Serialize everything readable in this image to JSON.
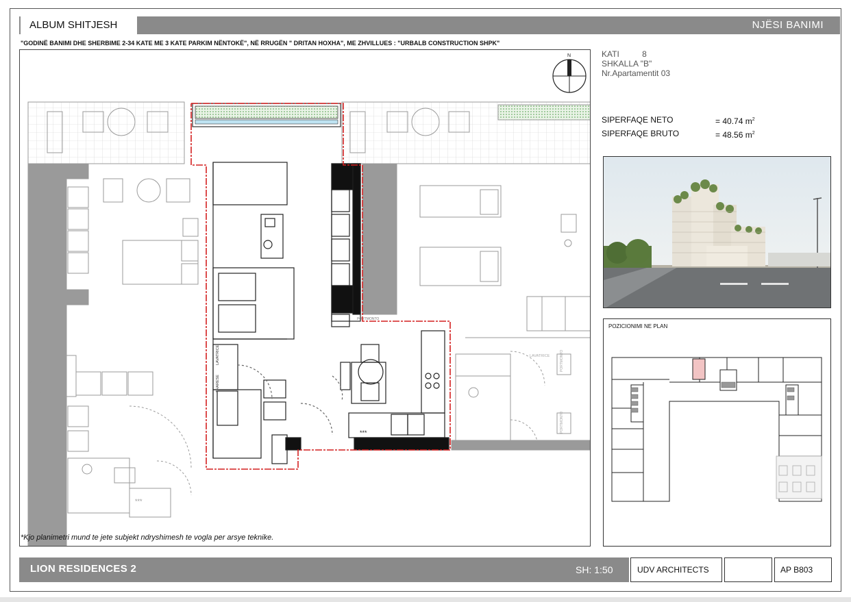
{
  "header": {
    "album_title": "ALBUM SHITJESH",
    "unit_title": "NJËSI BANIMI",
    "subtitle": "\"GODINË BANIMI DHE SHERBIME 2-34 KATE  ME 3 KATE PARKIM NËNTOKË\", NË RRUGËN \" DRITAN HOXHA\", ME  ZHVILLUES : \"URBALB CONSTRUCTION SHPK\""
  },
  "unit_info": {
    "floor_label": "KATI",
    "floor_value": "8",
    "stair": "SHKALLA \"B\"",
    "apartment": "Nr.Apartamentit  03"
  },
  "areas": {
    "net_label": "SIPERFAQE NETO",
    "net_value": "= 40.74 m",
    "gross_label": "SIPERFAQE BRUTO",
    "gross_value": "= 48.56 m",
    "unit_sup": "2"
  },
  "plan": {
    "compass_label": "N",
    "lavatrice_left": "LAVATRICE",
    "tharese": "THARESE",
    "lavatrice_right": "LAVATRICE",
    "portmonto_1": "PORTMONTO",
    "portmonto_2": "PORTMONTO",
    "portmonto_3": "PORTMONTO",
    "stars_1": "***",
    "stars_2": "***"
  },
  "location": {
    "title": "POZICIONIMI NE PLAN"
  },
  "note": "*Kjo planimetri mund te jete subjekt ndryshimesh te vogla per arsye teknike.",
  "footer": {
    "project": "LION  RESIDENCES 2",
    "scale": "SH: 1:50",
    "architect": "UDV ARCHITECTS",
    "code": "AP  B803"
  },
  "colors": {
    "bar_gray": "#8a8a8a",
    "unit_outline": "#d41f1f",
    "highlight": "#f2c4c4"
  }
}
